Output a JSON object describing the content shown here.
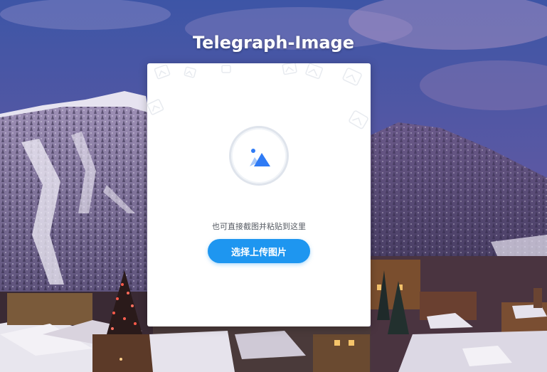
{
  "site": {
    "title": "Telegraph-Image"
  },
  "upload": {
    "paste_hint": "也可直接截图并粘贴到这里",
    "select_button_label": "选择上传图片",
    "icon": "image-upload-icon",
    "accent_color": "#1e96f0",
    "icon_color": "#2f7bf5"
  },
  "background": {
    "description_icon": "snowy-mountain-village-photo"
  }
}
